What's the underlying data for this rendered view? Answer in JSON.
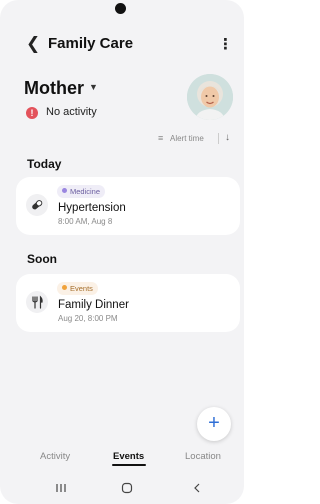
{
  "app_bar": {
    "back_icon": "chevron-left-icon",
    "title": "Family Care",
    "more_icon": "more-vertical-icon"
  },
  "profile": {
    "name": "Mother",
    "dropdown_icon": "caret-down-icon",
    "status_icon": "alert-icon",
    "status_text": "No activity",
    "avatar_icon": "elderly-woman-avatar"
  },
  "sort": {
    "label": "Alert time",
    "sort_icon": "sort-lines-icon",
    "direction_icon": "arrow-down-icon"
  },
  "sections": [
    {
      "title": "Today",
      "items": [
        {
          "icon": "pill-icon",
          "category": "Medicine",
          "category_color": "#9a86e0",
          "title": "Hypertension",
          "subtitle": "8:00 AM, Aug 8"
        }
      ]
    },
    {
      "title": "Soon",
      "items": [
        {
          "icon": "utensils-icon",
          "category": "Events",
          "category_color": "#f0a23a",
          "title": "Family Dinner",
          "subtitle": "Aug 20, 8:00 PM"
        }
      ]
    }
  ],
  "fab": {
    "icon": "plus-icon",
    "color": "#2f6fd6"
  },
  "tabs": [
    {
      "label": "Activity",
      "active": false
    },
    {
      "label": "Events",
      "active": true
    },
    {
      "label": "Location",
      "active": false
    }
  ],
  "system_nav": {
    "recents_icon": "recents-icon",
    "home_icon": "home-icon",
    "back_icon": "back-icon"
  }
}
